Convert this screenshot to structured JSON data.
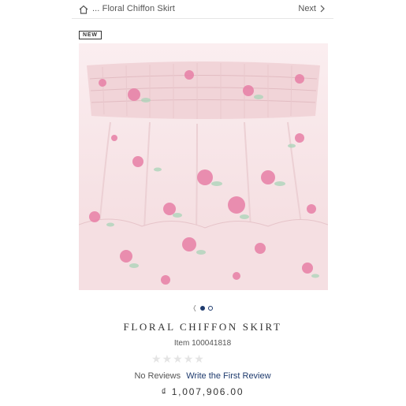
{
  "breadcrumb": {
    "home_icon": "home-icon",
    "text": "... Floral Chiffon Skirt"
  },
  "nav": {
    "next_label": "Next",
    "next_icon": "chevron-right-icon"
  },
  "badge": {
    "label": "NEW"
  },
  "gallery": {
    "image_icon": "product-photo",
    "carousel_left_icon": "chevron-left-icon",
    "slide_count": 2,
    "active_slide": 1
  },
  "product": {
    "title": "FLORAL CHIFFON SKIRT",
    "item_number": "Item 100041818",
    "rating": 0,
    "max_rating": 5,
    "no_reviews_label": "No Reviews",
    "write_review_label": "Write the First Review",
    "price": "₫ 1,007,906.00"
  },
  "colors": {
    "accent": "#1f3b6e",
    "fabric": "#f6e3e4",
    "flower": "#e77fa6",
    "leaf": "#a9d4b8"
  }
}
